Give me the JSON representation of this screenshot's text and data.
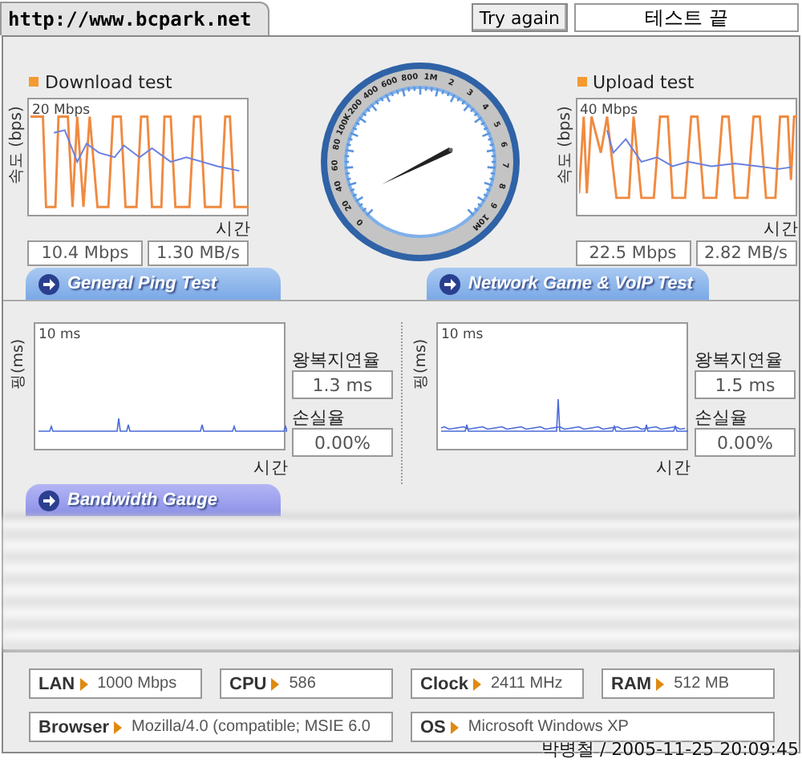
{
  "header": {
    "site_tab": "http://www.bcpark.net",
    "retry_button": "Try again",
    "status": "테스트 끝"
  },
  "speed_tests": [
    {
      "kind": "download",
      "title": "Download test",
      "y_axis": "속도 (bps)",
      "scale": "20 Mbps",
      "x_axis": "시간",
      "bitrate": "10.4 Mbps",
      "byterate": "1.30 MB/s"
    },
    {
      "kind": "upload",
      "title": "Upload test",
      "y_axis": "속도 (bps)",
      "scale": "40 Mbps",
      "x_axis": "시간",
      "bitrate": "22.5 Mbps",
      "byterate": "2.82 MB/s"
    }
  ],
  "gauge": {
    "labels": [
      "0",
      "20",
      "40",
      "60",
      "80",
      "100K",
      "200",
      "400",
      "600",
      "800",
      "1M",
      "2",
      "3",
      "4",
      "5",
      "6",
      "7",
      "8",
      "9",
      "10M"
    ]
  },
  "ping_tests": [
    {
      "tab": "General Ping Test",
      "y_axis": "핑(ms)",
      "scale": "10 ms",
      "x_axis": "시간",
      "latency_label": "왕복지연율",
      "latency": "1.3 ms",
      "loss_label": "손실율",
      "loss": "0.00%"
    },
    {
      "tab": "Network Game & VoIP Test",
      "y_axis": "핑(ms)",
      "scale": "10 ms",
      "x_axis": "시간",
      "latency_label": "왕복지연율",
      "latency": "1.5 ms",
      "loss_label": "손실율",
      "loss": "0.00%"
    }
  ],
  "bandwidth_tab": "Bandwidth Gauge",
  "system_info": [
    {
      "label": "LAN",
      "value": "1000 Mbps"
    },
    {
      "label": "CPU",
      "value": "586"
    },
    {
      "label": "Clock",
      "value": "2411 MHz"
    },
    {
      "label": "RAM",
      "value": "512 MB"
    },
    {
      "label": "Browser",
      "value": "Mozilla/4.0 (compatible; MSIE 6.0"
    },
    {
      "label": "OS",
      "value": "Microsoft Windows XP"
    }
  ],
  "stamp": "박병철 / 2005-11-25 20:09:45"
}
